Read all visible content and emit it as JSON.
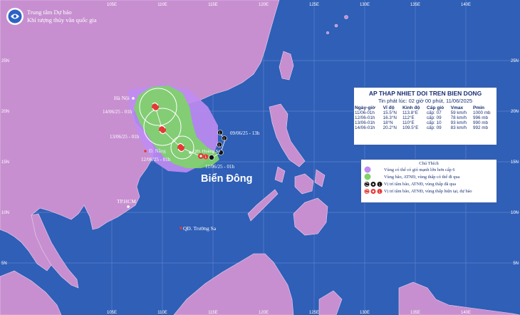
{
  "agency": {
    "line1": "Trung tâm Dự báo",
    "line2": "Khí tượng thủy văn quốc gia"
  },
  "lon_labels": [
    "105E",
    "110E",
    "115E",
    "120E",
    "125E",
    "130E",
    "135E",
    "140E"
  ],
  "lat_labels": [
    "25N",
    "20N",
    "15N",
    "10N",
    "5N"
  ],
  "places": {
    "hanoi": "Hà Nội",
    "danang": "Đ. Nẵng",
    "hoangsa": "QĐ. Hoàng Sa",
    "hcm": "TP.HCM",
    "truongsa": "QĐ. Trường Sa",
    "sea": "Biển Đông"
  },
  "track_labels": {
    "t_1406": "14/06/25 - 01h",
    "t_1306": "13/06/25 - 01h",
    "t_1206": "12/06/25 - 01h",
    "t_1106": "11/06/25 - 01h",
    "t_0906": "09/06/25 - 13h"
  },
  "info": {
    "title": "AP THAP NHIET DOI TREN BIEN DONG",
    "subtitle": "Tin phát lúc: 02 giờ 00 phút, 11/06/2025",
    "headers": [
      "Ngày-giờ",
      "Vĩ độ",
      "Kinh độ",
      "Cấp gió",
      "Vmax",
      "Pmin"
    ],
    "rows": [
      [
        "11/06-01h",
        "15.5°N",
        "113.8°E",
        "cấp: 07",
        "59 km/h",
        "1000 mb"
      ],
      [
        "12/06-01h",
        "16.3°N",
        "112°E",
        "cấp: 09",
        "78 km/h",
        "996 mb"
      ],
      [
        "13/06-01h",
        "18°N",
        "110°E",
        "cấp: 10",
        "93 km/h",
        "990 mb"
      ],
      [
        "14/06-01h",
        "20.2°N",
        "109.5°E",
        "cấp: 09",
        "83 km/h",
        "992 mb"
      ]
    ]
  },
  "legend": {
    "title": "Chú Thích",
    "items": [
      "Vùng có thể có gió mạnh lớn hơn cấp 6",
      "Vùng bão, ATNĐ, vùng thấp có thể đi qua",
      "Vị trí tâm bão, ATNĐ, vùng thấp đã qua",
      "Vị trí tâm bão, ATNĐ, vùng thấp hiện tại, dự báo"
    ]
  },
  "colors": {
    "sea": "#2f5fb7",
    "land": "#c78fd0",
    "wind_zone": "#c08cf2",
    "track_cone": "#7fd26a",
    "storm_current": "#e53935",
    "storm_past": "#111111"
  }
}
